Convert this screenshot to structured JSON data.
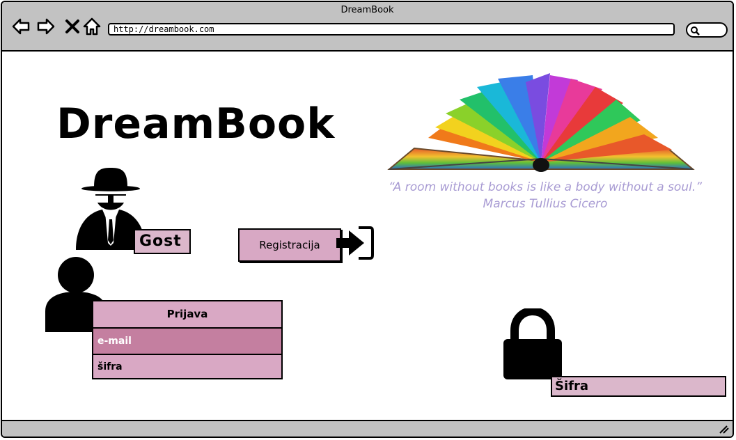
{
  "window": {
    "title": "DreamBook",
    "url": "http://dreambook.com"
  },
  "icons": {
    "back": "left-arrow",
    "forward": "right-arrow",
    "stop": "x",
    "home": "house",
    "search": "magnifier",
    "guest": "spy",
    "user": "person",
    "signin": "sign-in",
    "lock": "padlock",
    "book": "open-book"
  },
  "page": {
    "logo": "DreamBook",
    "quote_line1": "“A room without books is like a body without a soul.”",
    "quote_line2": "Marcus Tullius Cicero",
    "guest_label": "Gost",
    "register_button": "Registracija",
    "login": {
      "header": "Prijava",
      "email_field": "e-mail",
      "password_field": "šifra"
    },
    "password_label": "Šifra"
  },
  "colors": {
    "quote": "#a89bd3",
    "pink": "#d8a8c4",
    "pink_dark": "#c47fa0",
    "chrome": "#c2c2c2"
  }
}
